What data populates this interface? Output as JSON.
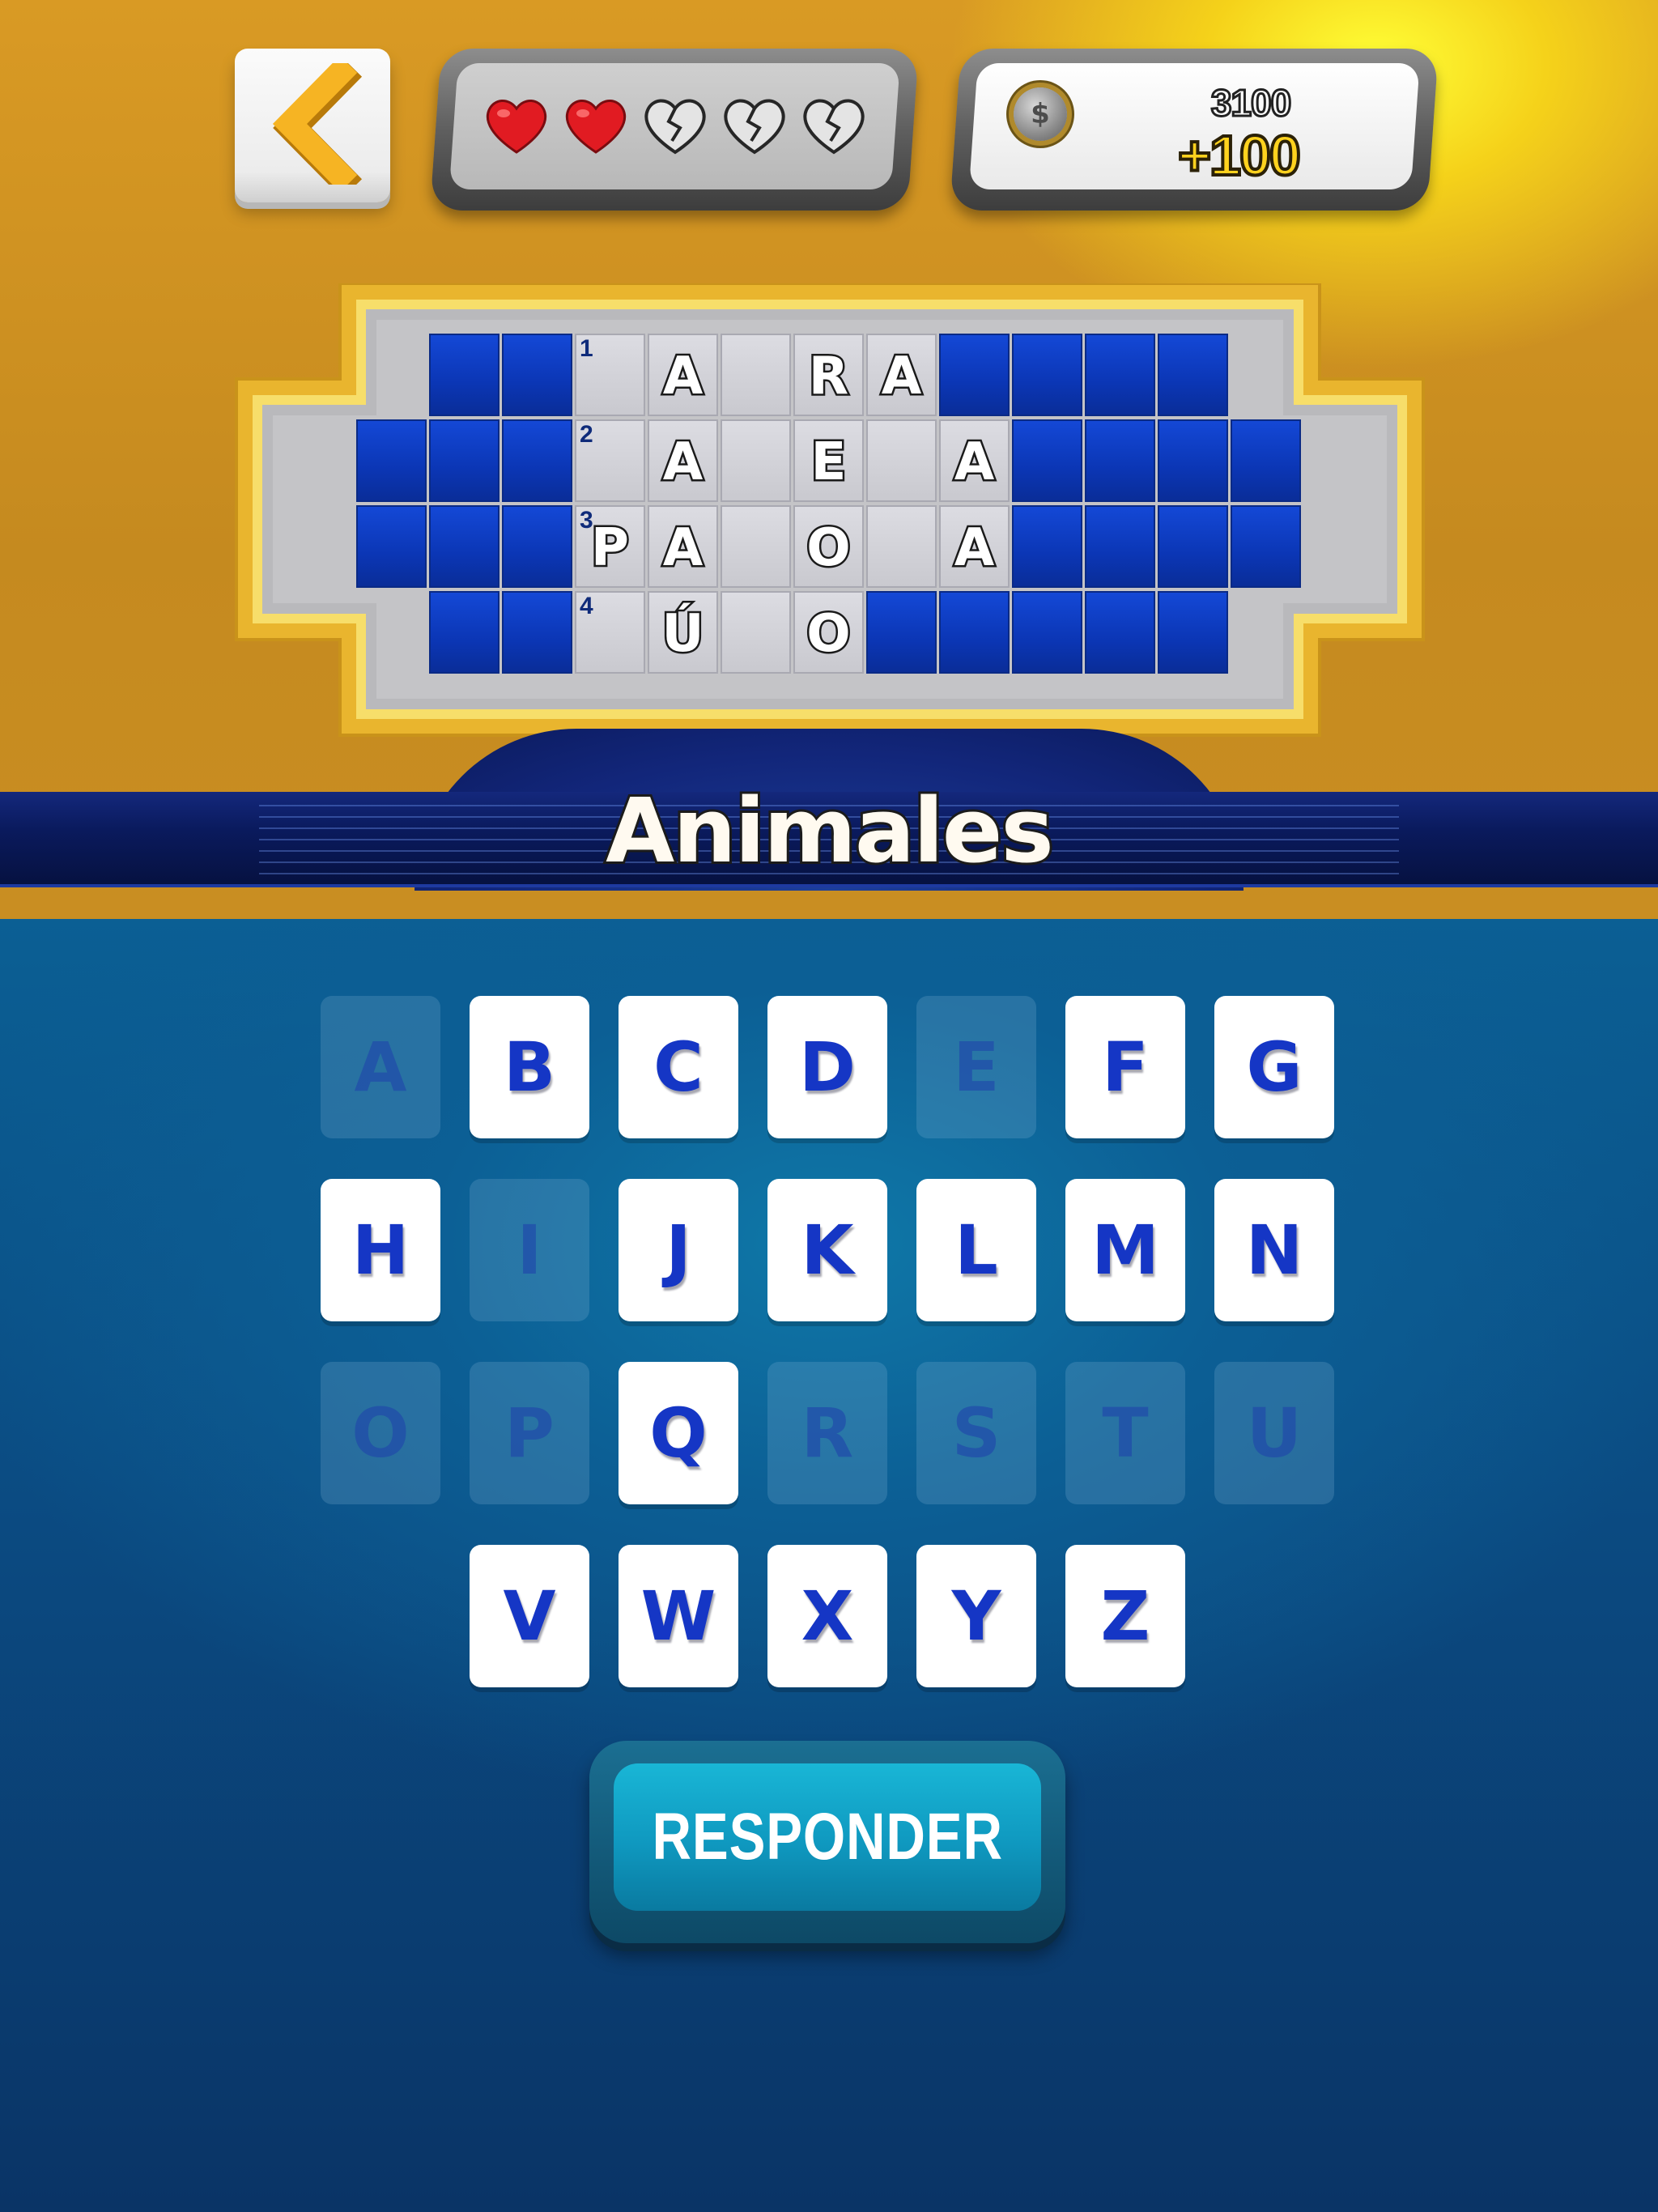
{
  "header": {
    "back_icon": "chevron-left-icon",
    "lives": {
      "remaining": 2,
      "total": 5,
      "full_icon": "heart-icon",
      "broken_icon": "broken-heart-icon"
    },
    "coins": {
      "icon": "coin-icon",
      "icon_symbol": "$",
      "total": "3100",
      "bonus": "+100"
    }
  },
  "board": {
    "rows": [
      {
        "number": "1",
        "cells": [
          "",
          "A",
          "",
          "R",
          "A"
        ]
      },
      {
        "number": "2",
        "cells": [
          "",
          "A",
          "",
          "E",
          "",
          "A"
        ]
      },
      {
        "number": "3",
        "cells": [
          "P",
          "A",
          "",
          "O",
          "",
          "A"
        ]
      },
      {
        "number": "4",
        "cells": [
          "",
          "Ú",
          "",
          "O"
        ]
      }
    ]
  },
  "category": {
    "title": "Animales"
  },
  "keyboard": {
    "rows": [
      [
        "A",
        "B",
        "C",
        "D",
        "E",
        "F",
        "G"
      ],
      [
        "H",
        "I",
        "J",
        "K",
        "L",
        "M",
        "N"
      ],
      [
        "O",
        "P",
        "Q",
        "R",
        "S",
        "T",
        "U"
      ],
      [
        "V",
        "W",
        "X",
        "Y",
        "Z"
      ]
    ],
    "used": [
      "A",
      "E",
      "I",
      "O",
      "P",
      "R",
      "S",
      "T",
      "U"
    ]
  },
  "responder": {
    "label": "RESPONDER"
  },
  "colors": {
    "key_letter": "#1536c5",
    "board_blue": "#0b36b5",
    "accent_yellow": "#ffd21e",
    "responder_teal": "#11a7cc"
  }
}
